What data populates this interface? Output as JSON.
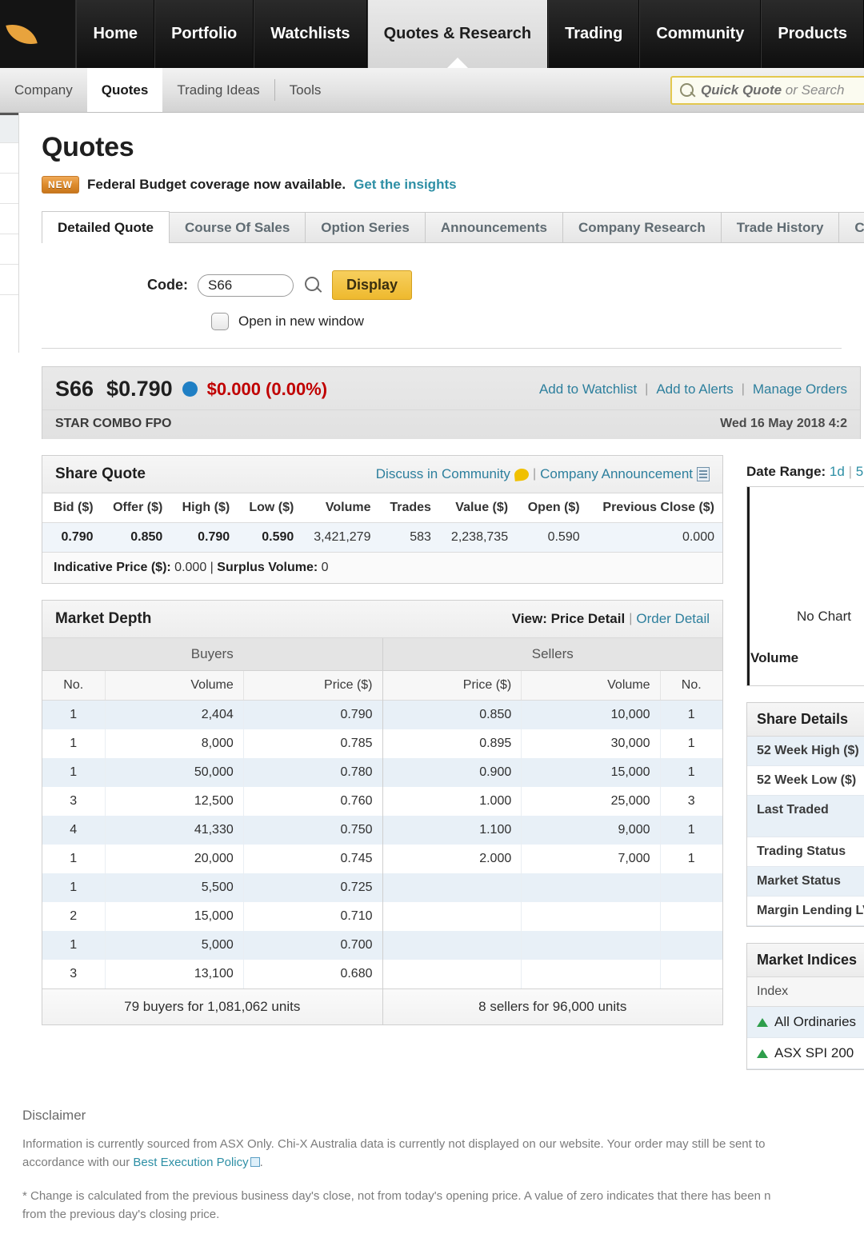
{
  "topnav": {
    "items": [
      {
        "label": "Home",
        "active": false
      },
      {
        "label": "Portfolio",
        "active": false
      },
      {
        "label": "Watchlists",
        "active": false
      },
      {
        "label": "Quotes & Research",
        "active": true
      },
      {
        "label": "Trading",
        "active": false
      },
      {
        "label": "Community",
        "active": false
      },
      {
        "label": "Products",
        "active": false
      }
    ]
  },
  "subnav": {
    "items": [
      {
        "label": "Company",
        "active": false
      },
      {
        "label": "Quotes",
        "active": true
      },
      {
        "label": "Trading Ideas",
        "active": false
      },
      {
        "label": "Tools",
        "active": false
      }
    ],
    "search_placeholder_bold": "Quick Quote",
    "search_placeholder_rest": " or Search"
  },
  "page": {
    "title": "Quotes",
    "promo_badge": "NEW",
    "promo_text": "Federal Budget coverage now available.",
    "promo_link": "Get the insights"
  },
  "tabs": [
    {
      "label": "Detailed Quote",
      "active": true
    },
    {
      "label": "Course Of Sales",
      "active": false
    },
    {
      "label": "Option Series",
      "active": false
    },
    {
      "label": "Announcements",
      "active": false
    },
    {
      "label": "Company Research",
      "active": false
    },
    {
      "label": "Trade History",
      "active": false
    },
    {
      "label": "Charts",
      "active": false
    }
  ],
  "form": {
    "code_label": "Code:",
    "code_value": "S66",
    "display_button": "Display",
    "new_window_label": "Open in new window"
  },
  "quote_header": {
    "code": "S66",
    "price": "$0.790",
    "change": "$0.000 (0.00%)",
    "company_name": "STAR COMBO FPO",
    "timestamp": "Wed 16 May 2018 4:2",
    "links": [
      "Add to Watchlist",
      "Add to Alerts",
      "Manage Orders"
    ],
    "change_color": "#c00000",
    "dot_color": "#1f7fc4"
  },
  "share_quote": {
    "title": "Share Quote",
    "discuss_link": "Discuss in Community",
    "announcement_link": "Company Announcement",
    "headers": [
      "Bid ($)",
      "Offer ($)",
      "High ($)",
      "Low ($)",
      "Volume",
      "Trades",
      "Value ($)",
      "Open ($)",
      "Previous Close ($)"
    ],
    "values": [
      "0.790",
      "0.850",
      "0.790",
      "0.590",
      "3,421,279",
      "583",
      "2,238,735",
      "0.590",
      "0.000"
    ],
    "indicative_label": "Indicative Price ($):",
    "indicative_value": "0.000",
    "surplus_label": "Surplus Volume:",
    "surplus_value": "0"
  },
  "market_depth": {
    "title": "Market Depth",
    "view_label": "View: Price Detail",
    "view_link": "Order Detail",
    "buyers_label": "Buyers",
    "sellers_label": "Sellers",
    "buyer_headers": [
      "No.",
      "Volume",
      "Price ($)"
    ],
    "seller_headers": [
      "Price ($)",
      "Volume",
      "No."
    ],
    "buyers": [
      {
        "no": "1",
        "volume": "2,404",
        "price": "0.790"
      },
      {
        "no": "1",
        "volume": "8,000",
        "price": "0.785"
      },
      {
        "no": "1",
        "volume": "50,000",
        "price": "0.780"
      },
      {
        "no": "3",
        "volume": "12,500",
        "price": "0.760"
      },
      {
        "no": "4",
        "volume": "41,330",
        "price": "0.750"
      },
      {
        "no": "1",
        "volume": "20,000",
        "price": "0.745"
      },
      {
        "no": "1",
        "volume": "5,500",
        "price": "0.725"
      },
      {
        "no": "2",
        "volume": "15,000",
        "price": "0.710"
      },
      {
        "no": "1",
        "volume": "5,000",
        "price": "0.700"
      },
      {
        "no": "3",
        "volume": "13,100",
        "price": "0.680"
      }
    ],
    "sellers": [
      {
        "price": "0.850",
        "volume": "10,000",
        "no": "1"
      },
      {
        "price": "0.895",
        "volume": "30,000",
        "no": "1"
      },
      {
        "price": "0.900",
        "volume": "15,000",
        "no": "1"
      },
      {
        "price": "1.000",
        "volume": "25,000",
        "no": "3"
      },
      {
        "price": "1.100",
        "volume": "9,000",
        "no": "1"
      },
      {
        "price": "2.000",
        "volume": "7,000",
        "no": "1"
      },
      {
        "price": "",
        "volume": "",
        "no": ""
      },
      {
        "price": "",
        "volume": "",
        "no": ""
      },
      {
        "price": "",
        "volume": "",
        "no": ""
      },
      {
        "price": "",
        "volume": "",
        "no": ""
      }
    ],
    "buyers_summary": "79 buyers for 1,081,062 units",
    "sellers_summary": "8 sellers for 96,000 units"
  },
  "rail": {
    "date_range_label": "Date Range:",
    "date_range_options": [
      "1d",
      "5"
    ],
    "no_chart_text": "No Chart",
    "volume_label": "Volume",
    "share_details": {
      "title": "Share Details",
      "rows": [
        "52 Week High ($)",
        "52 Week Low ($)",
        "Last Traded",
        "Trading Status",
        "Market Status",
        "Margin Lending LV"
      ]
    },
    "market_indices": {
      "title": "Market Indices",
      "column_header": "Index",
      "rows": [
        "All Ordinaries",
        "ASX SPI 200"
      ]
    }
  },
  "disclaimer": {
    "title": "Disclaimer",
    "paragraph1_a": "Information is currently sourced from ASX Only. Chi-X Australia data is currently not displayed on our website. Your order may still be sent to ",
    "paragraph1_b": "accordance with our ",
    "policy_link": "Best Execution Policy",
    "paragraph2": "* Change is calculated from the previous business day's close, not from today's opening price. A value of zero indicates that there has been n",
    "paragraph2_b": "from the previous day's closing price."
  }
}
